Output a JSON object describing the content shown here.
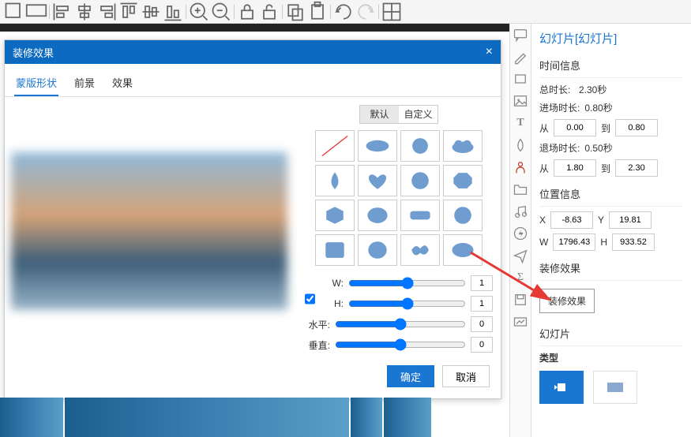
{
  "dialog": {
    "title": "装修效果",
    "tabs": [
      "蒙版形状",
      "前景",
      "效果"
    ],
    "active_tab": 0,
    "shape_tabs": [
      "默认",
      "自定义"
    ],
    "active_shape_tab": 0,
    "sliders": {
      "w_label": "W:",
      "h_label": "H:",
      "horiz_label": "水平:",
      "vert_label": "垂直:",
      "w_val": "1",
      "h_val": "1",
      "horiz_val": "0",
      "vert_val": "0"
    },
    "ok": "确定",
    "cancel": "取消"
  },
  "props": {
    "title": "幻灯片[幻灯片]",
    "time_section": "时间信息",
    "total_label": "总时长:",
    "total_val": "2.30秒",
    "enter_label": "进场时长:",
    "enter_val": "0.80秒",
    "from_label": "从",
    "to_label": "到",
    "from1": "0.00",
    "to1": "0.80",
    "exit_label": "退场时长:",
    "exit_val": "0.50秒",
    "from2": "1.80",
    "to2": "2.30",
    "pos_section": "位置信息",
    "x_label": "X",
    "x_val": "-8.63",
    "y_label": "Y",
    "y_val": "19.81",
    "w_label": "W",
    "w_val": "1796.43",
    "h_label": "H",
    "h_val": "933.52",
    "effect_section": "装修效果",
    "effect_btn": "装修效果",
    "slide_section": "幻灯片",
    "type_label": "类型"
  }
}
